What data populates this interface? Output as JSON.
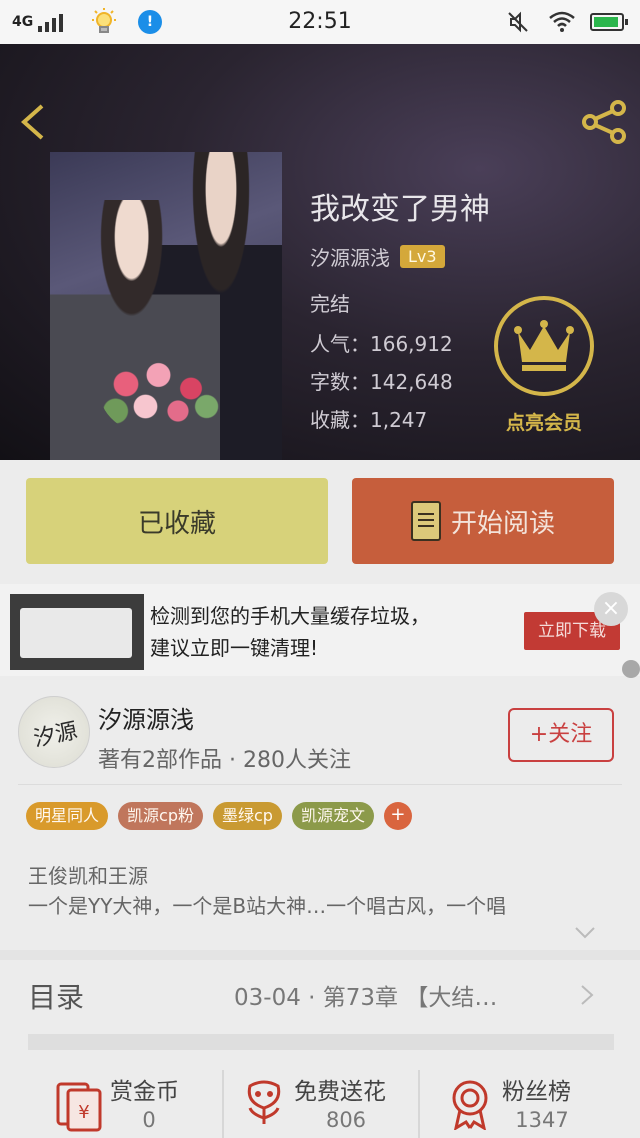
{
  "status_bar": {
    "network": "4G",
    "time": "22:51",
    "notice_badge": "!"
  },
  "book": {
    "title": "我改变了男神",
    "author": "汐源源浅",
    "level": "Lv3",
    "status": "完结",
    "popularity": "人气：166,912",
    "word_count": "字数：142,648",
    "favorites": "收藏：1,247"
  },
  "vip": {
    "label": "点亮会员"
  },
  "actions": {
    "favorited_label": "已收藏",
    "read_label": "开始阅读"
  },
  "ad": {
    "line1": "检测到您的手机大量缓存垃圾，",
    "line2": "建议立即一键清理!",
    "button": "立即下载",
    "close": "×"
  },
  "author_card": {
    "avatar_text": "汐源",
    "name": "汐源源浅",
    "meta": "著有2部作品 · 280人关注",
    "follow_label": "+关注"
  },
  "tags": [
    {
      "label": "明星同人",
      "color": "#d99a2b"
    },
    {
      "label": "凯源cp粉",
      "color": "#c0765c"
    },
    {
      "label": "墨绿cp",
      "color": "#c99a32"
    },
    {
      "label": "凯源宠文",
      "color": "#8c9a4a"
    }
  ],
  "tag_add": "+",
  "description": {
    "line1": "王俊凯和王源",
    "line2": "一个是YY大神，一个是B站大神…一个唱古风，一个唱"
  },
  "toc": {
    "title": "目录",
    "latest": "03-04 · 第73章 【大结…"
  },
  "bottom_bar": {
    "reward": {
      "label": "赏金币",
      "count": "0"
    },
    "flowers": {
      "label": "免费送花",
      "count": "806"
    },
    "fans": {
      "label": "粉丝榜",
      "count": "1347"
    }
  },
  "colors": {
    "accent_gold": "#d4b64a",
    "read_button": "#c65e3c",
    "fav_button": "#d7d27a",
    "follow_red": "#c94040"
  }
}
